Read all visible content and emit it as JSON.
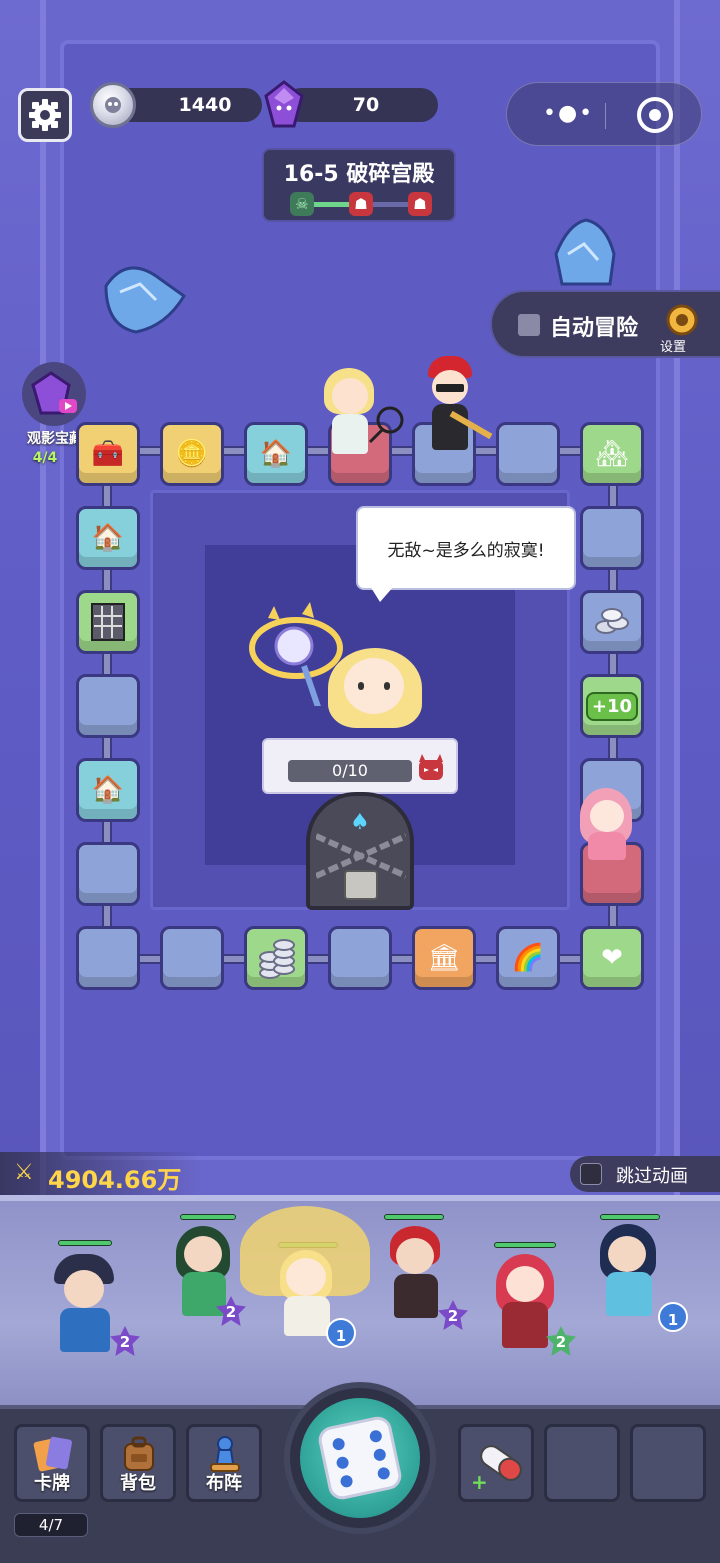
{
  "hud": {
    "silver_amount": "1440",
    "gem_amount": "70",
    "stage_title": "16-5 破碎宫殿",
    "auto_adventure_label": "自动冒险",
    "auto_settings_label": "设置",
    "treasure_label": "观影宝藏",
    "treasure_count": "4/4"
  },
  "board": {
    "speech_text": "无敌~是多么的寂寞!",
    "boss_progress_text": "0/10",
    "boss_progress": 0,
    "plus_tile_label": "+10"
  },
  "bottom": {
    "power_value": "4904.66万",
    "skip_animation_label": "跳过动画",
    "cards_label": "卡牌",
    "bag_label": "背包",
    "formation_label": "布阵",
    "cards_count": "4/7"
  },
  "team": [
    {
      "level": "2"
    },
    {
      "level": "2"
    },
    {
      "level": "1"
    },
    {
      "level": "2"
    },
    {
      "level": "2"
    },
    {
      "level": "1"
    }
  ],
  "colors": {
    "accent_gold": "#ffd54a",
    "hp_green": "#4fc86e",
    "dice_teal": "#2fa197"
  }
}
